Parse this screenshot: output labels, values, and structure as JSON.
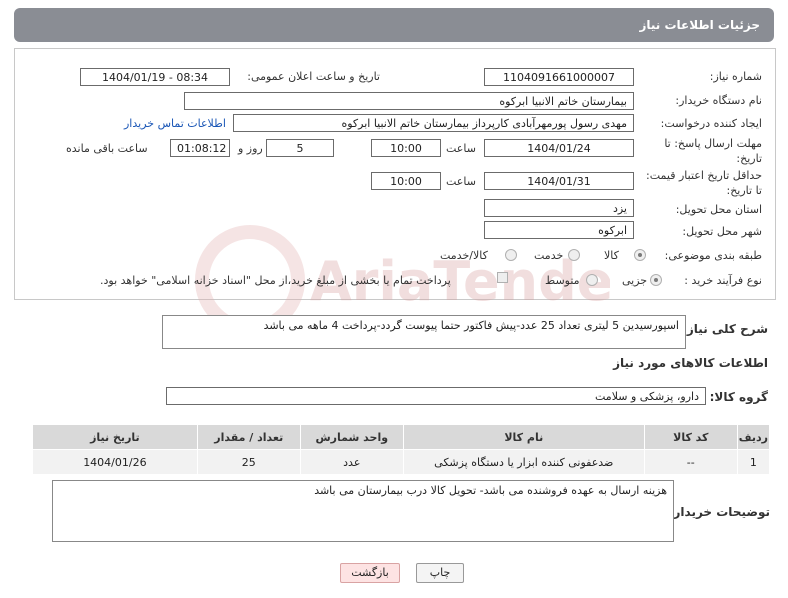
{
  "header": {
    "title": "جزئیات اطلاعات نیاز"
  },
  "fields": {
    "need_number_label": "شماره نیاز:",
    "need_number": "1104091661000007",
    "announce_label": "تاریخ و ساعت اعلان عمومی:",
    "announce_value": "1404/01/19 - 08:34",
    "buyer_org_label": "نام دستگاه خریدار:",
    "buyer_org": "بیمارستان خاتم الانبیا ابرکوه",
    "creator_label": "ایجاد کننده درخواست:",
    "creator": "مهدی رسول پورمهرآبادی کارپرداز بیمارستان خاتم الانبیا ابرکوه",
    "contact_link": "اطلاعات تماس خریدار",
    "reply_deadline_label": "مهلت ارسال پاسخ: تا تاریخ:",
    "reply_date": "1404/01/24",
    "time_label": "ساعت",
    "reply_time": "10:00",
    "days_value": "5",
    "days_label": "روز و",
    "remaining_time": "01:08:12",
    "remaining_label": "ساعت باقی مانده",
    "price_validity_label": "حداقل تاریخ اعتبار قیمت: تا تاریخ:",
    "price_date": "1404/01/31",
    "price_time": "10:00",
    "province_label": "استان محل تحویل:",
    "province": "یزد",
    "city_label": "شهر محل تحویل:",
    "city": "ابرکوه",
    "category_label": "طبقه بندی موضوعی:",
    "category_options": [
      "کالا",
      "خدمت",
      "کالا/خدمت"
    ],
    "process_label": "نوع فرآیند خرید :",
    "process_options": [
      "جزیی",
      "متوسط"
    ],
    "payment_note": "پرداخت تمام یا بخشی از مبلغ خرید،از محل \"اسناد خزانه اسلامی\" خواهد بود."
  },
  "description": {
    "label": "شرح کلی نیاز:",
    "text": "اسپورسیدین 5 لیتری تعداد 25 عدد-پیش فاکتور حتما پیوست گردد-پرداخت 4 ماهه می باشد"
  },
  "goods": {
    "section_title": "اطلاعات کالاهای مورد نیاز",
    "group_label": "گروه کالا:",
    "group_value": "دارو، پزشکی و سلامت",
    "columns": [
      "ردیف",
      "کد کالا",
      "نام کالا",
      "واحد شمارش",
      "تعداد / مقدار",
      "تاریخ نیاز"
    ],
    "rows": [
      [
        "1",
        "--",
        "ضدعفونی کننده ابزار یا دستگاه پزشکی",
        "عدد",
        "25",
        "1404/01/26"
      ]
    ]
  },
  "buyer_notes": {
    "label": "توضیحات خریدار:",
    "text": "هزینه ارسال به عهده فروشنده می باشد- تحویل کالا درب بیمارستان می باشد"
  },
  "buttons": {
    "print": "چاپ",
    "back": "بازگشت"
  },
  "watermark": {
    "text": "AriaTender.neT"
  }
}
